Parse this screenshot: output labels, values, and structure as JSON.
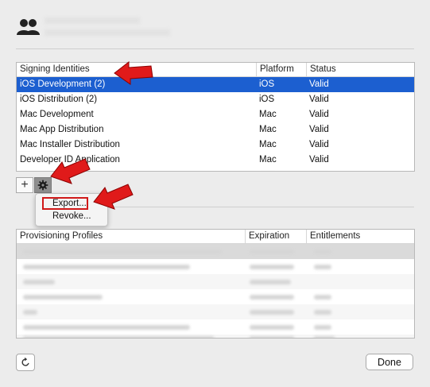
{
  "signing": {
    "headers": [
      "Signing Identities",
      "Platform",
      "Status"
    ],
    "rows": [
      {
        "name": "iOS Development (2)",
        "platform": "iOS",
        "status": "Valid"
      },
      {
        "name": "iOS Distribution (2)",
        "platform": "iOS",
        "status": "Valid"
      },
      {
        "name": "Mac Development",
        "platform": "Mac",
        "status": "Valid"
      },
      {
        "name": "Mac App Distribution",
        "platform": "Mac",
        "status": "Valid"
      },
      {
        "name": "Mac Installer Distribution",
        "platform": "Mac",
        "status": "Valid"
      },
      {
        "name": "Developer ID Application",
        "platform": "Mac",
        "status": "Valid"
      }
    ]
  },
  "toolbar": {
    "add_label": "+"
  },
  "menu": {
    "export_label": "Export...",
    "revoke_label": "Revoke..."
  },
  "profiles": {
    "headers": [
      "Provisioning Profiles",
      "Expiration",
      "Entitlements"
    ]
  },
  "footer": {
    "done_label": "Done"
  },
  "colors": {
    "selection": "#1c5fd0",
    "annotation_red": "#e01a1a"
  },
  "icons": {
    "account": "people-icon",
    "gear": "gear-icon",
    "refresh": "refresh-icon"
  }
}
